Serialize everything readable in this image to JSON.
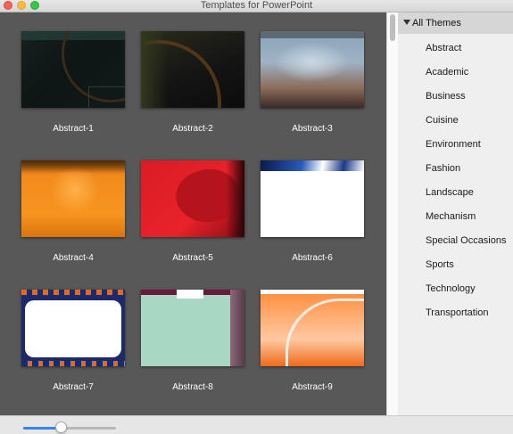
{
  "window": {
    "title": "Templates for PowerPoint"
  },
  "gallery": {
    "templates": [
      {
        "label": "Abstract-1"
      },
      {
        "label": "Abstract-2"
      },
      {
        "label": "Abstract-3"
      },
      {
        "label": "Abstract-4"
      },
      {
        "label": "Abstract-5"
      },
      {
        "label": "Abstract-6"
      },
      {
        "label": "Abstract-7"
      },
      {
        "label": "Abstract-8"
      },
      {
        "label": "Abstract-9"
      }
    ]
  },
  "sidebar": {
    "header": "All Themes",
    "items": [
      {
        "label": "Abstract"
      },
      {
        "label": "Academic"
      },
      {
        "label": "Business"
      },
      {
        "label": "Cuisine"
      },
      {
        "label": "Environment"
      },
      {
        "label": "Fashion"
      },
      {
        "label": "Landscape"
      },
      {
        "label": "Mechanism"
      },
      {
        "label": "Special Occasions"
      },
      {
        "label": "Sports"
      },
      {
        "label": "Technology"
      },
      {
        "label": "Transportation"
      }
    ]
  },
  "zoom_slider": {
    "value_fraction": 0.41,
    "accent_color": "#3b82f0"
  },
  "colors": {
    "gallery_background": "#585858",
    "sidebar_background": "#efefef",
    "sidebar_header_background": "#d6d6d6"
  }
}
